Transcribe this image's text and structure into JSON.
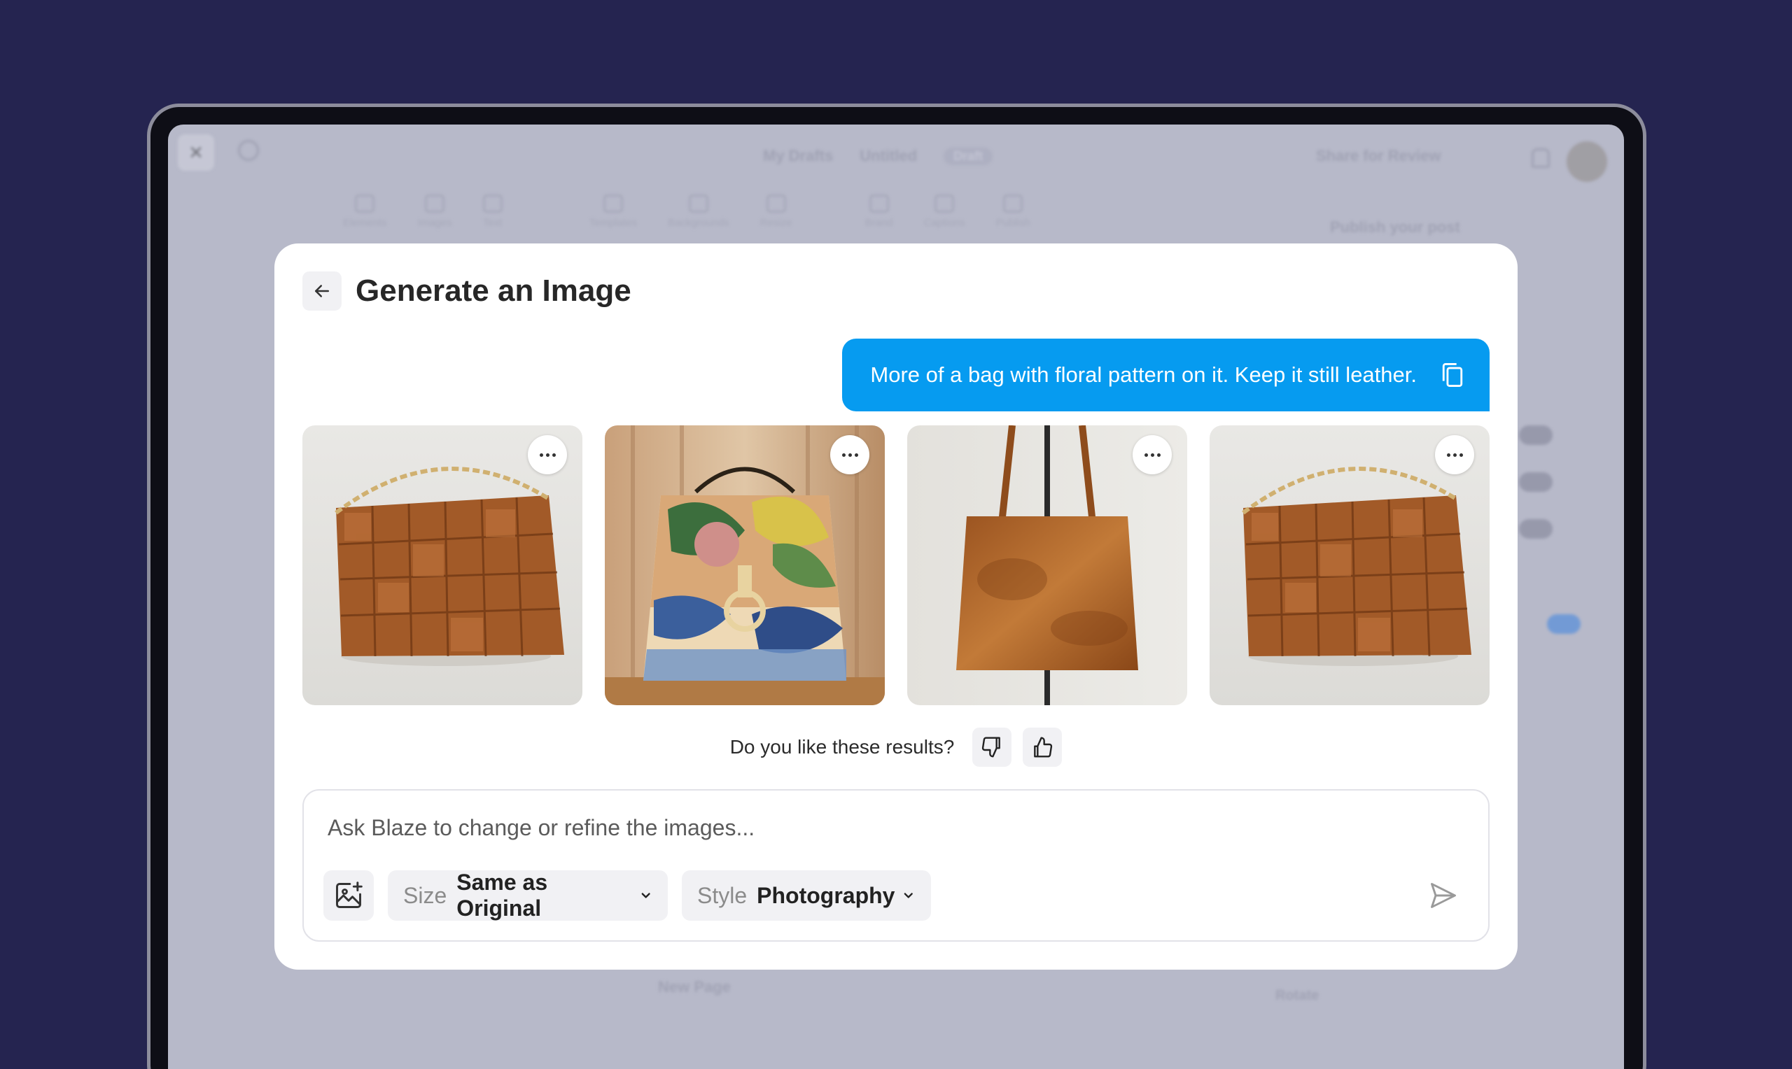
{
  "background_app": {
    "breadcrumb": [
      "My Drafts",
      "Untitled"
    ],
    "draft_badge": "Draft",
    "share_label": "Share for Review",
    "toolbar": [
      "Elements",
      "Images",
      "Text",
      "Templates",
      "Backgrounds",
      "Resize",
      "Brand",
      "Captions",
      "Publish"
    ],
    "publish_heading": "Publish your post",
    "new_page_label": "New Page",
    "rotate_label": "Rotate"
  },
  "modal": {
    "title": "Generate an Image",
    "prompt": "More of a bag with floral pattern on it. Keep it still leather.",
    "images": [
      {
        "subject": "woven brown leather tote with gold chain"
      },
      {
        "subject": "floral pattern leather handbag"
      },
      {
        "subject": "plain brown leather tote hanging"
      },
      {
        "subject": "woven brown leather tote with gold chain"
      }
    ],
    "feedback_question": "Do you like these results?",
    "composer": {
      "placeholder": "Ask Blaze to change or refine the images...",
      "size_label": "Size",
      "size_value": "Same as Original",
      "style_label": "Style",
      "style_value": "Photography"
    }
  },
  "colors": {
    "page_bg": "#252450",
    "prompt_bubble": "#069bf0",
    "leather": "#a25a28"
  }
}
